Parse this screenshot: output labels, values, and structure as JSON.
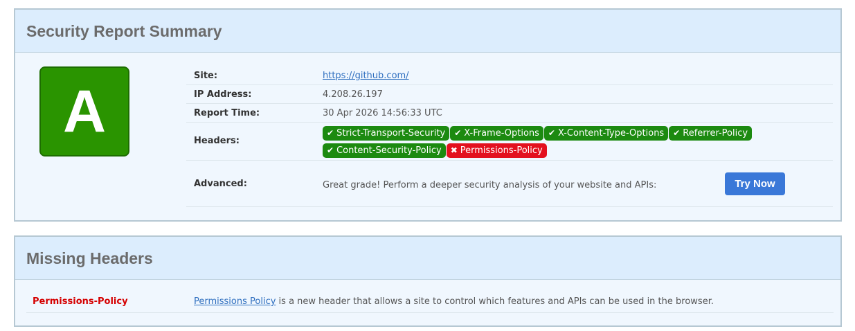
{
  "summary": {
    "title": "Security Report Summary",
    "grade": "A",
    "grade_color": "#2a9400",
    "rows": {
      "site_label": "Site:",
      "site_value": "https://github.com/",
      "ip_label": "IP Address:",
      "ip_value": "4.208.26.197",
      "time_label": "Report Time:",
      "time_value": "30 Apr 2026 14:56:33 UTC",
      "headers_label": "Headers:",
      "advanced_label": "Advanced:",
      "advanced_text": "Great grade! Perform a deeper security analysis of your website and APIs:"
    },
    "headers": [
      {
        "name": "Strict-Transport-Security",
        "status": "present",
        "icon": "check-icon"
      },
      {
        "name": "X-Frame-Options",
        "status": "present",
        "icon": "check-icon"
      },
      {
        "name": "X-Content-Type-Options",
        "status": "present",
        "icon": "check-icon"
      },
      {
        "name": "Referrer-Policy",
        "status": "present",
        "icon": "check-icon"
      },
      {
        "name": "Content-Security-Policy",
        "status": "present",
        "icon": "check-icon"
      },
      {
        "name": "Permissions-Policy",
        "status": "missing",
        "icon": "cross-icon"
      }
    ],
    "try_button_label": "Try Now",
    "colors": {
      "present": "#1c8a10",
      "missing": "#e3101e",
      "button": "#3a78d8"
    }
  },
  "missing": {
    "title": "Missing Headers",
    "items": [
      {
        "name": "Permissions-Policy",
        "link_text": "Permissions Policy",
        "description": " is a new header that allows a site to control which features and APIs can be used in the browser."
      }
    ]
  }
}
